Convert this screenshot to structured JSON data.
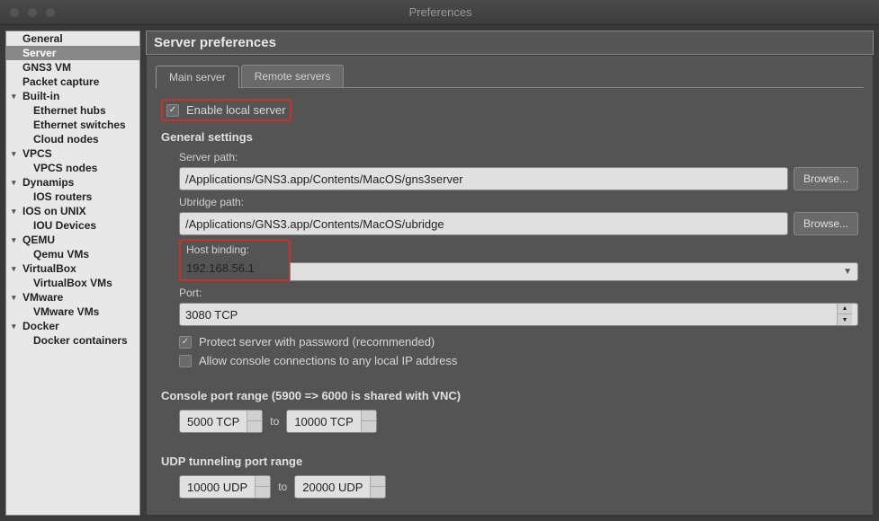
{
  "window": {
    "title": "Preferences"
  },
  "sidebar": {
    "items": [
      {
        "label": "General",
        "expandable": false
      },
      {
        "label": "Server",
        "expandable": false,
        "selected": true
      },
      {
        "label": "GNS3 VM",
        "expandable": false
      },
      {
        "label": "Packet capture",
        "expandable": false
      },
      {
        "label": "Built-in",
        "expandable": true,
        "children": [
          {
            "label": "Ethernet hubs"
          },
          {
            "label": "Ethernet switches"
          },
          {
            "label": "Cloud nodes"
          }
        ]
      },
      {
        "label": "VPCS",
        "expandable": true,
        "children": [
          {
            "label": "VPCS nodes"
          }
        ]
      },
      {
        "label": "Dynamips",
        "expandable": true,
        "children": [
          {
            "label": "IOS routers"
          }
        ]
      },
      {
        "label": "IOS on UNIX",
        "expandable": true,
        "children": [
          {
            "label": "IOU Devices"
          }
        ]
      },
      {
        "label": "QEMU",
        "expandable": true,
        "children": [
          {
            "label": "Qemu VMs"
          }
        ]
      },
      {
        "label": "VirtualBox",
        "expandable": true,
        "children": [
          {
            "label": "VirtualBox VMs"
          }
        ]
      },
      {
        "label": "VMware",
        "expandable": true,
        "children": [
          {
            "label": "VMware VMs"
          }
        ]
      },
      {
        "label": "Docker",
        "expandable": true,
        "children": [
          {
            "label": "Docker containers"
          }
        ]
      }
    ]
  },
  "header": {
    "title": "Server preferences"
  },
  "tabs": {
    "main": "Main server",
    "remote": "Remote servers"
  },
  "form": {
    "enable_local_server": "Enable local server",
    "general_settings": "General settings",
    "server_path_label": "Server path:",
    "server_path_value": "/Applications/GNS3.app/Contents/MacOS/gns3server",
    "ubridge_path_label": "Ubridge path:",
    "ubridge_path_value": "/Applications/GNS3.app/Contents/MacOS/ubridge",
    "host_binding_label": "Host binding:",
    "host_binding_value": "192.168.56.1",
    "port_label": "Port:",
    "port_value": "3080 TCP",
    "browse_label": "Browse...",
    "protect_password": "Protect server with password (recommended)",
    "allow_console": "Allow console connections to any local IP address",
    "console_port_range": "Console port range (5900 => 6000 is shared with VNC)",
    "console_port_from": "5000 TCP",
    "console_port_to": "10000 TCP",
    "to_label": "to",
    "udp_tunneling": "UDP tunneling port range",
    "udp_port_from": "10000 UDP",
    "udp_port_to": "20000 UDP"
  }
}
